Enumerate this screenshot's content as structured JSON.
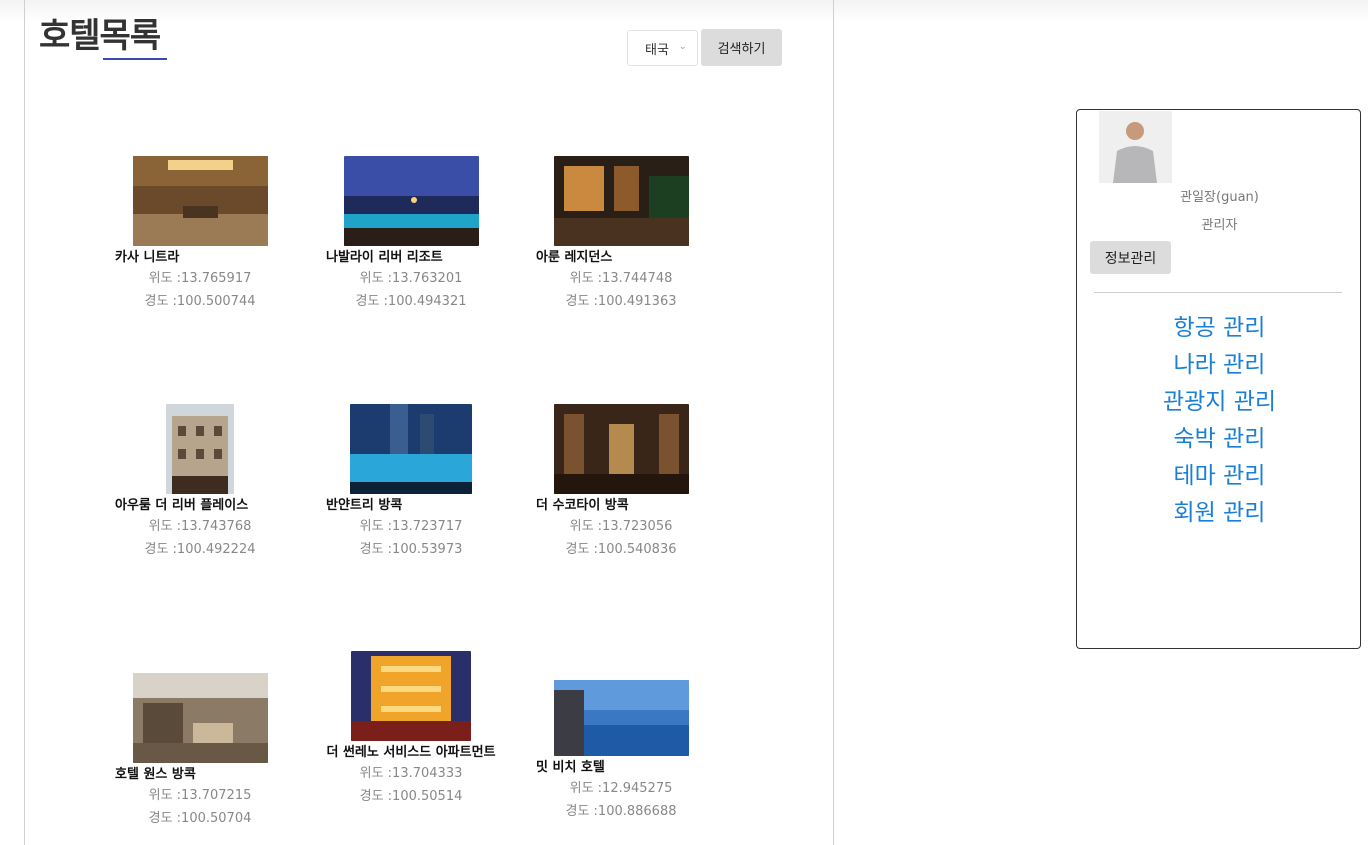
{
  "page": {
    "title": "호텔목록",
    "country_selected": "태국",
    "search_label": "검색하기"
  },
  "hotels": [
    {
      "name": "카사 니트라",
      "lat": "위도 :13.765917",
      "lng": "경도 :100.500744"
    },
    {
      "name": "나발라이 리버 리조트",
      "lat": "위도 :13.763201",
      "lng": "경도 :100.494321"
    },
    {
      "name": "아룬 레지던스",
      "lat": "위도 :13.744748",
      "lng": "경도 :100.491363"
    },
    {
      "name": "아우룸 더 리버 플레이스",
      "lat": "위도 :13.743768",
      "lng": "경도 :100.492224"
    },
    {
      "name": "반얀트리 방콕",
      "lat": "위도 :13.723717",
      "lng": "경도 :100.53973"
    },
    {
      "name": "더 수코타이 방콕",
      "lat": "위도 :13.723056",
      "lng": "경도 :100.540836"
    },
    {
      "name": "호텔 원스 방콕",
      "lat": "위도 :13.707215",
      "lng": "경도 :100.50704"
    },
    {
      "name": "더 썬레노 서비스드 아파트먼트",
      "lat": "위도 :13.704333",
      "lng": "경도 :100.50514"
    },
    {
      "name": "밋 비치 호텔",
      "lat": "위도 :12.945275",
      "lng": "경도 :100.886688"
    }
  ],
  "sidebar": {
    "user_name": "관일장(guan)",
    "user_role": "관리자",
    "info_button": "정보관리",
    "menu": [
      "항공 관리",
      "나라 관리",
      "관광지 관리",
      "숙박 관리",
      "테마 관리",
      "회원 관리"
    ]
  },
  "colors": {
    "link": "#1a7fd6",
    "title_underline": "#3b4aa8",
    "button_bg": "#dcdcdc"
  },
  "icons": {
    "select_chevron": "chevron-down-icon"
  }
}
